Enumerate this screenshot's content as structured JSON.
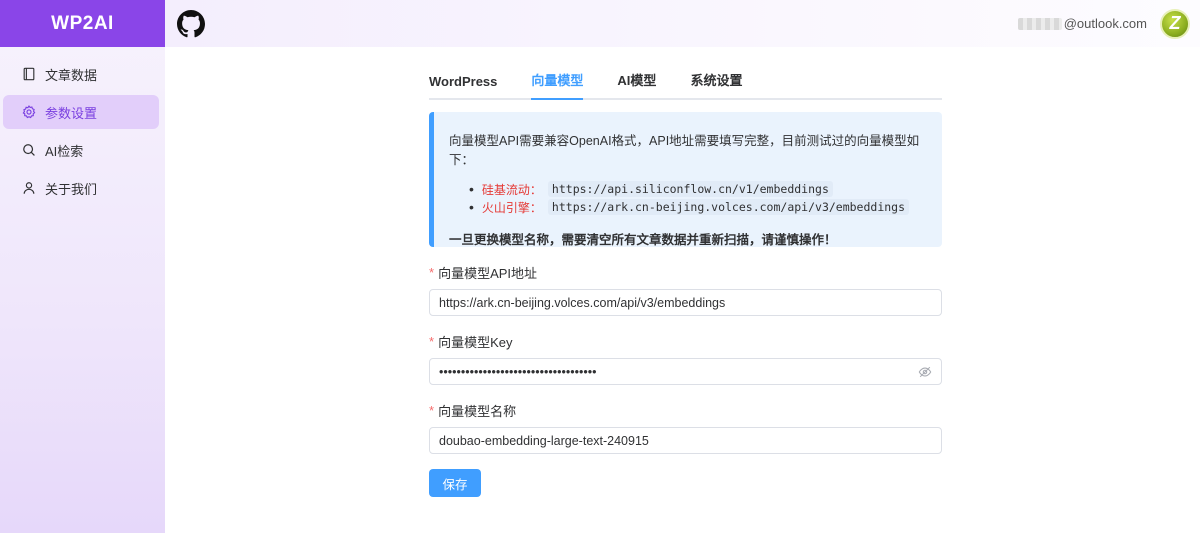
{
  "sidebar": {
    "logo": "WP2AI",
    "items": [
      {
        "label": "文章数据",
        "icon": "notebook-icon"
      },
      {
        "label": "参数设置",
        "icon": "gear-icon"
      },
      {
        "label": "AI检索",
        "icon": "search-icon"
      },
      {
        "label": "关于我们",
        "icon": "user-icon"
      }
    ],
    "active_index": 1
  },
  "header": {
    "github_icon": "github-icon",
    "email": "@outlook.com",
    "avatar_letter": "Z"
  },
  "tabs": [
    {
      "label": "WordPress"
    },
    {
      "label": "向量模型"
    },
    {
      "label": "AI模型"
    },
    {
      "label": "系统设置"
    }
  ],
  "active_tab": 1,
  "alert": {
    "intro": "向量模型API需要兼容OpenAI格式，API地址需要填写完整，目前测试过的向量模型如下：",
    "providers": [
      {
        "name": "硅基流动：",
        "url": "https://api.siliconflow.cn/v1/embeddings"
      },
      {
        "name": "火山引擎：",
        "url": "https://ark.cn-beijing.volces.com/api/v3/embeddings"
      }
    ],
    "warning": "一旦更换模型名称，需要清空所有文章数据并重新扫描，请谨慎操作！"
  },
  "form": {
    "api_url": {
      "label": "向量模型API地址",
      "value": "https://ark.cn-beijing.volces.com/api/v3/embeddings"
    },
    "api_key": {
      "label": "向量模型Key",
      "value": "••••••••••••••••••••••••••••••••••••"
    },
    "model_name": {
      "label": "向量模型名称",
      "value": "doubao-embedding-large-text-240915"
    },
    "required_mark": "*",
    "save_label": "保存"
  },
  "colors": {
    "accent": "#409eff",
    "brand": "#8a45e8",
    "danger": "#e53935"
  }
}
